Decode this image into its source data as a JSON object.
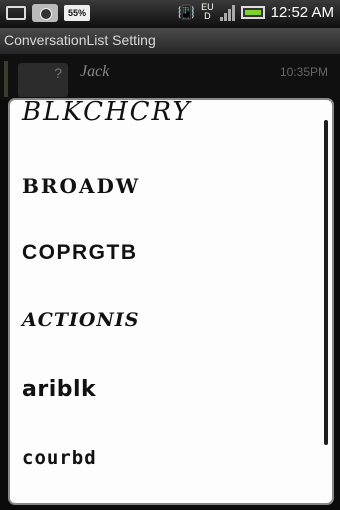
{
  "status_bar": {
    "battery_percent": "55%",
    "network": "EU",
    "network_sub": "D",
    "time": "12:52 AM"
  },
  "title": "ConversationList Setting",
  "background_row": {
    "name": "Jack",
    "time": "10:35PM"
  },
  "dialog": {
    "options": [
      "BLKCHCRY",
      "BROADW",
      "COPRGTB",
      "ACTIONIS",
      "ariblk",
      "courbd"
    ]
  }
}
